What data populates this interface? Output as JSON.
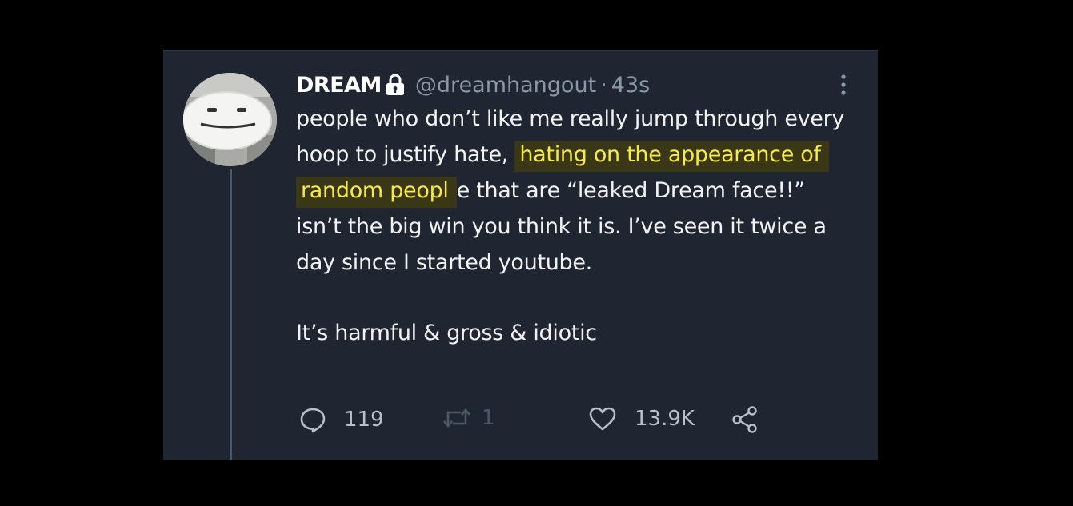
{
  "tweet": {
    "display_name": "DREAM",
    "handle": "@dreamhangout",
    "separator": "·",
    "time": "43s",
    "text_before_highlight": "people who don’t like me really jump through every hoop to justify hate, ",
    "text_highlight": "hating on the appearance of random peopl",
    "text_after_highlight": "e that are “leaked Dream face!!” isn’t the big win you think it is. I’ve seen it twice a day since I started youtube.",
    "text_second_paragraph": "It’s harmful & gross & idiotic",
    "icons": {
      "lock": "lock-icon",
      "more": "more-vertical-icon",
      "reply": "reply-icon",
      "retweet": "retweet-icon",
      "like": "heart-icon",
      "share": "share-icon"
    }
  },
  "actions": {
    "replies": "119",
    "retweets": "1",
    "likes": "13.9K"
  },
  "colors": {
    "background": "#000000",
    "card": "#1f2631",
    "highlight_text": "#f6e94a",
    "highlight_bg": "#3a3716",
    "muted": "#8b98a5"
  }
}
